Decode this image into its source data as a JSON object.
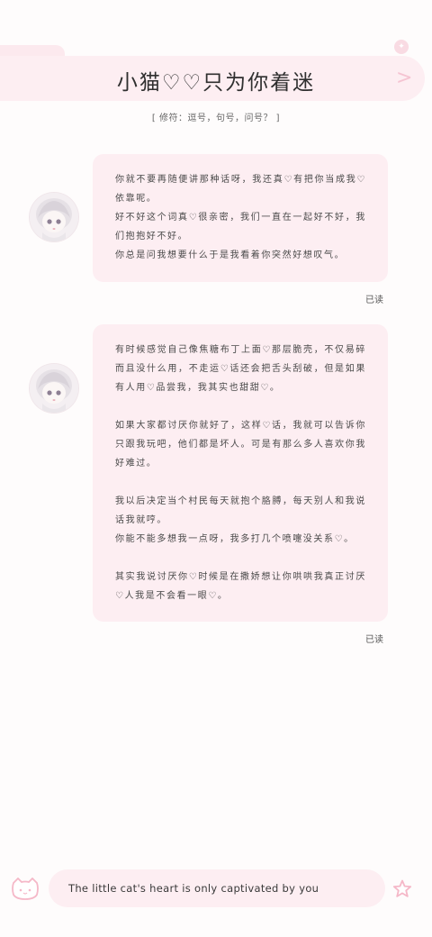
{
  "header": {
    "title": "小猫♡♡只为你着迷",
    "subtitle": "[ 修符：逗号，句号，问号？ ]",
    "next_icon": "chevron-right-icon"
  },
  "messages": [
    {
      "paragraphs": [
        "你就不要再随便讲那种话呀，我还真♡有把你当成我♡依靠呢。\n好不好这个词真♡很亲密，我们一直在一起好不好，我们抱抱好不好。\n你总是问我想要什么于是我看着你突然好想叹气。"
      ],
      "status": "已读"
    },
    {
      "paragraphs": [
        "有时候感觉自己像焦糖布丁上面♡那层脆壳，不仅易碎而且没什么用，不走运♡话还会把舌头刮破，但是如果有人用♡品尝我，我其实也甜甜♡。",
        "如果大家都讨厌你就好了，这样♡话，我就可以告诉你只跟我玩吧，他们都是坏人。可是有那么多人喜欢你我好难过。",
        "我以后决定当个村民每天就抱个胳膊，每天别人和我说话我就哼。\n你能不能多想我一点呀，我多打几个喷嚏没关系♡。",
        "其实我说讨厌你♡时候是在撒娇想让你哄哄我真正讨厌♡人我是不会看一眼♡。"
      ],
      "status": "已读"
    }
  ],
  "input_bar": {
    "text": "The little cat's heart is only captivated by you"
  },
  "colors": {
    "accent_pink": "#fdeef2",
    "icon_pink": "#f5b8c8"
  }
}
